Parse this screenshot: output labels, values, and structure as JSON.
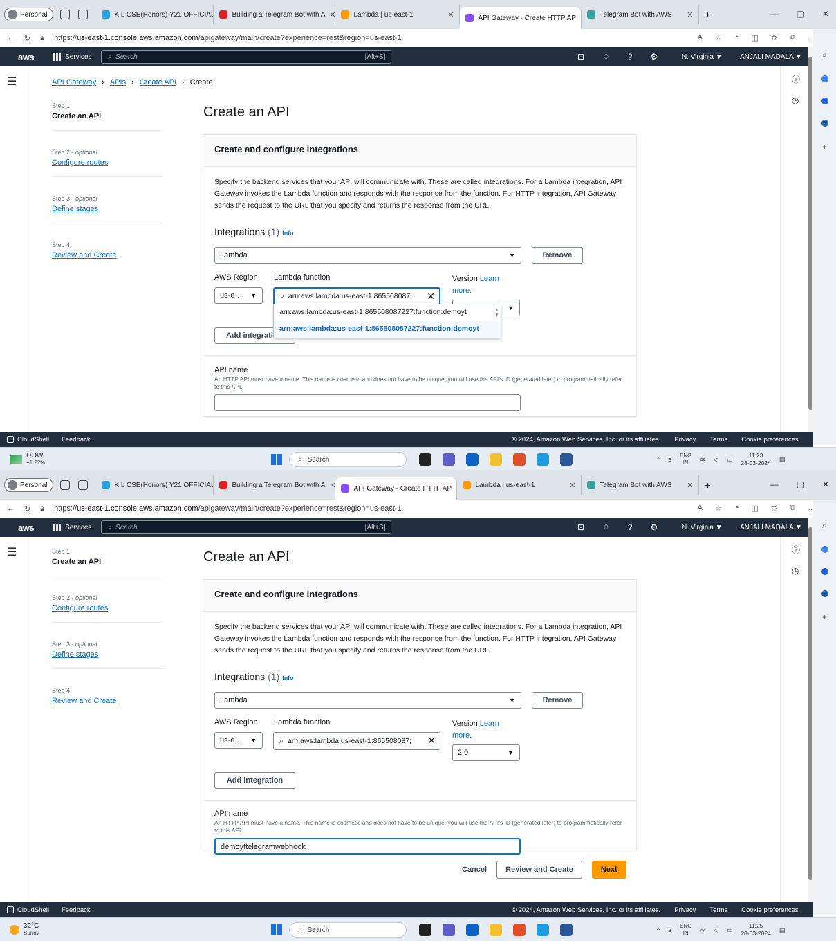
{
  "browser": {
    "profile": "Personal",
    "url_prefix": "https://",
    "url_domain": "us-east-1.console.aws.amazon.com",
    "url_path": "/apigateway/main/create?experience=rest&region=us-east-1"
  },
  "tabs_top": [
    {
      "label": "K L CSE(Honors) Y21 OFFICIAL",
      "color": "#2aa3e0"
    },
    {
      "label": "Building a Telegram Bot with A",
      "color": "#e02020"
    },
    {
      "label": "Lambda | us-east-1",
      "color": "#ff9900"
    },
    {
      "label": "API Gateway - Create HTTP AP",
      "color": "#8c4fff",
      "active": true
    },
    {
      "label": "Telegram Bot with AWS",
      "color": "#3aa0a0"
    }
  ],
  "tabs_bottom": [
    {
      "label": "K L CSE(Honors) Y21 OFFICIAL",
      "color": "#2aa3e0"
    },
    {
      "label": "Building a Telegram Bot with A",
      "color": "#e02020"
    },
    {
      "label": "API Gateway - Create HTTP AP",
      "color": "#8c4fff",
      "active": true
    },
    {
      "label": "Lambda | us-east-1",
      "color": "#ff9900"
    },
    {
      "label": "Telegram Bot with AWS",
      "color": "#3aa0a0"
    }
  ],
  "aws_nav": {
    "logo": "aws",
    "services": "Services",
    "search_placeholder": "Search",
    "search_shortcut": "[Alt+S]",
    "region": "N. Virginia ▼",
    "account": "ANJALI MADALA ▼"
  },
  "breadcrumb": [
    "API Gateway",
    "APIs",
    "Create API",
    "Create"
  ],
  "steps": [
    {
      "label": "Step 1",
      "optional": "",
      "name": "Create an API",
      "current": true
    },
    {
      "label": "Step 2 - ",
      "optional": "optional",
      "name": "Configure routes"
    },
    {
      "label": "Step 3 - ",
      "optional": "optional",
      "name": "Define stages"
    },
    {
      "label": "Step 4",
      "optional": "",
      "name": "Review and Create"
    }
  ],
  "page_title": "Create an API",
  "panel": {
    "title": "Create and configure integrations",
    "description": "Specify the backend services that your API will communicate with. These are called integrations. For a Lambda integration, API Gateway invokes the Lambda function and responds with the response from the function. For HTTP integration, API Gateway sends the request to the URL that you specify and returns the response from the URL.",
    "integrations_title": "Integrations",
    "integrations_count": "(1)",
    "info": "Info",
    "integration_type": "Lambda",
    "remove": "Remove",
    "aws_region_label": "AWS Region",
    "aws_region_value": "us-e…",
    "lambda_label": "Lambda function",
    "lambda_value": "arn:aws:lambda:us-east-1:865508087227:function:demoyt",
    "lambda_display": "arn:aws:lambda:us-east-1:865508087;",
    "version_label": "Version",
    "learn": "Learn",
    "more": "more.",
    "version_value": "2.0",
    "dropdown_options": [
      "arn:aws:lambda:us-east-1:865508087227:function:demoyt",
      "arn:aws:lambda:us-east-1:865508087227:function:demoyt"
    ],
    "add_integration": "Add integration",
    "add_integration_cut": "Add integrati",
    "api_name_label": "API name",
    "api_name_hint": "An HTTP API must have a name. This name is cosmetic and does not have to be unique; you will use the API's ID (generated later) to programmatically refer to this API.",
    "api_name_value": "demoyttelegramwebhook"
  },
  "footer_buttons": {
    "cancel": "Cancel",
    "review": "Review and Create",
    "next": "Next"
  },
  "aws_footer": {
    "cloudshell": "CloudShell",
    "feedback": "Feedback",
    "copyright": "© 2024, Amazon Web Services, Inc. or its affiliates.",
    "privacy": "Privacy",
    "terms": "Terms",
    "cookies": "Cookie preferences"
  },
  "taskbar_top": {
    "weather_title": "DOW",
    "weather_sub": "+1.22%",
    "search": "Search",
    "lang1": "ENG",
    "lang2": "IN",
    "time": "11:23",
    "date": "28-03-2024"
  },
  "taskbar_bottom": {
    "weather_title": "32°C",
    "weather_sub": "Sunny",
    "search": "Search",
    "lang1": "ENG",
    "lang2": "IN",
    "time": "11:25",
    "date": "28-03-2024"
  }
}
